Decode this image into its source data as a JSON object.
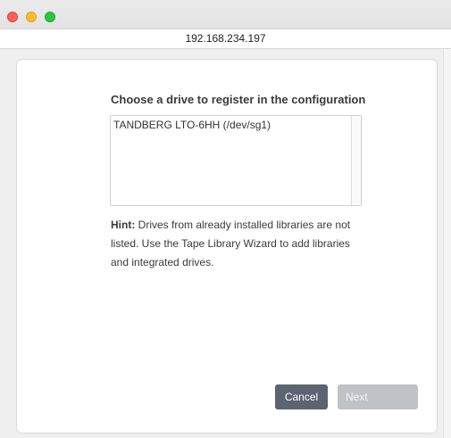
{
  "window": {
    "address": "192.168.234.197"
  },
  "dialog": {
    "heading": "Choose a drive to register in the configuration",
    "drives": [
      {
        "label": "TANDBERG LTO-6HH (/dev/sg1)"
      }
    ],
    "hint_label": "Hint:",
    "hint_text": " Drives from already installed libraries are not listed. Use the Tape Library Wizard to add libraries and integrated drives.",
    "buttons": {
      "cancel": "Cancel",
      "next": "Next"
    }
  }
}
